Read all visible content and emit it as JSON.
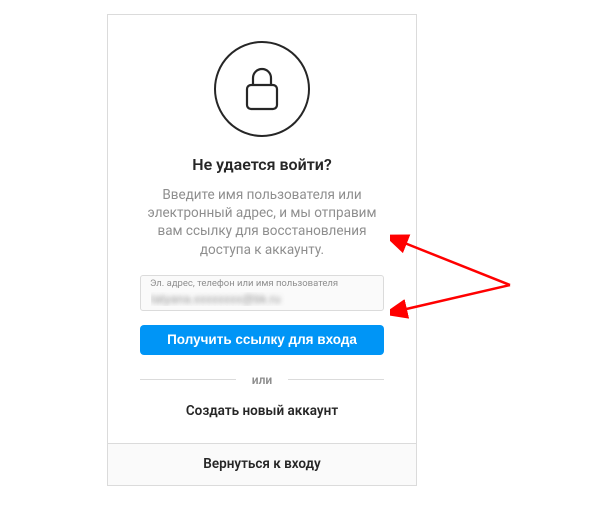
{
  "title": "Не удается войти?",
  "description": "Введите имя пользователя или электронный адрес, и мы отправим вам ссылку для восстановления доступа к аккаунту.",
  "input": {
    "label": "Эл. адрес, телефон или имя пользователя",
    "value": "tatyana.xxxxxxxx@bk.ru"
  },
  "submit_label": "Получить ссылку для входа",
  "divider_label": "или",
  "create_account_label": "Создать новый аккаунт",
  "back_label": "Вернуться к входу"
}
